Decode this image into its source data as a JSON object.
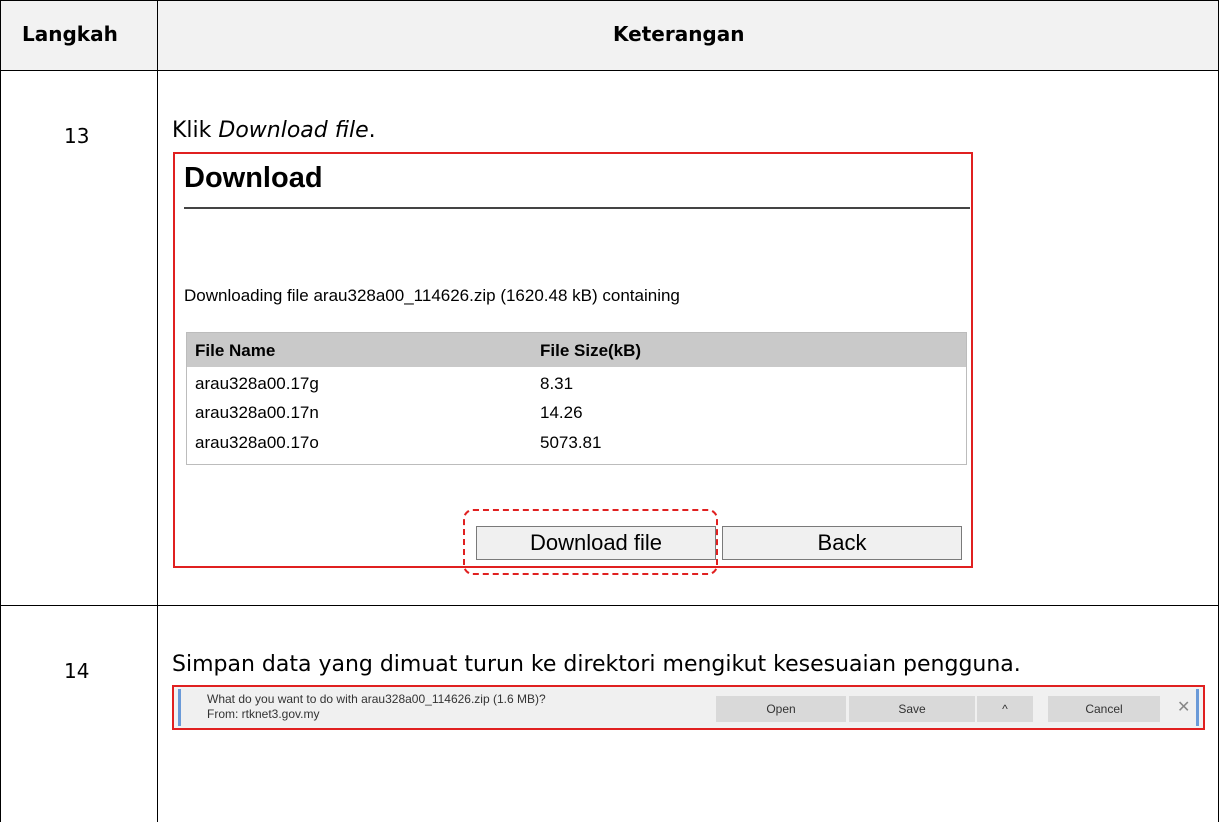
{
  "table": {
    "header_step": "Langkah",
    "header_desc": "Keterangan"
  },
  "steps": [
    {
      "number": "13",
      "text_prefix": "Klik ",
      "text_italic": "Download file",
      "text_suffix": "."
    },
    {
      "number": "14",
      "text": "Simpan data yang dimuat turun ke direktori mengikut kesesuaian pengguna."
    }
  ],
  "download_panel": {
    "title": "Download",
    "info": "Downloading file arau328a00_114626.zip (1620.48 kB) containing",
    "columns": [
      "File Name",
      "File Size(kB)"
    ],
    "rows": [
      [
        "arau328a00.17g",
        "8.31"
      ],
      [
        "arau328a00.17n",
        "14.26"
      ],
      [
        "arau328a00.17o",
        "5073.81"
      ]
    ],
    "download_button": "Download file",
    "back_button": "Back"
  },
  "save_bar": {
    "question": "What do you want to do with arau328a00_114626.zip (1.6 MB)?",
    "from": "From: rtknet3.gov.my",
    "open_button": "Open",
    "save_button": "Save",
    "more_icon": "chevron-up-icon",
    "more_glyph": "^",
    "cancel_button": "Cancel",
    "close_icon": "close-icon",
    "close_glyph": "✕"
  },
  "colors": {
    "highlight": "#e02020",
    "header_bg": "#f2f2f2",
    "table_head_bg": "#c9c9c9"
  }
}
